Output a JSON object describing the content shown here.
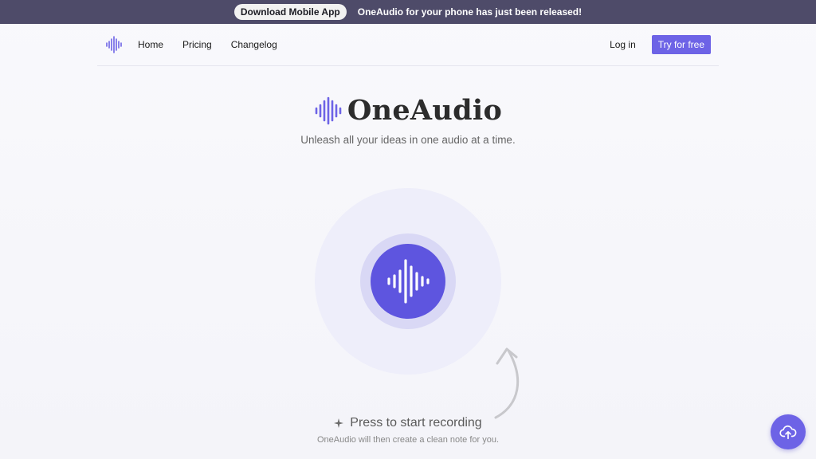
{
  "banner": {
    "button_label": "Download Mobile App",
    "text": "OneAudio for your phone has just been released!"
  },
  "nav": {
    "logo_icon": "waveform-icon",
    "links": [
      {
        "label": "Home"
      },
      {
        "label": "Pricing"
      },
      {
        "label": "Changelog"
      }
    ],
    "login_label": "Log in",
    "try_label": "Try for free"
  },
  "hero": {
    "logo_icon": "waveform-icon",
    "title": "OneAudio",
    "tagline": "Unleash all your ideas in one audio at a time."
  },
  "recorder": {
    "button_icon": "waveform-icon",
    "cta_icon": "sparkle-icon",
    "cta_label": "Press to start recording",
    "sub_label": "OneAudio will then create a clean note for you."
  },
  "upload": {
    "icon": "cloud-upload-icon"
  },
  "colors": {
    "accent": "#6d63e6",
    "banner_bg": "#4e4b69",
    "record_bg": "#5e55df"
  }
}
